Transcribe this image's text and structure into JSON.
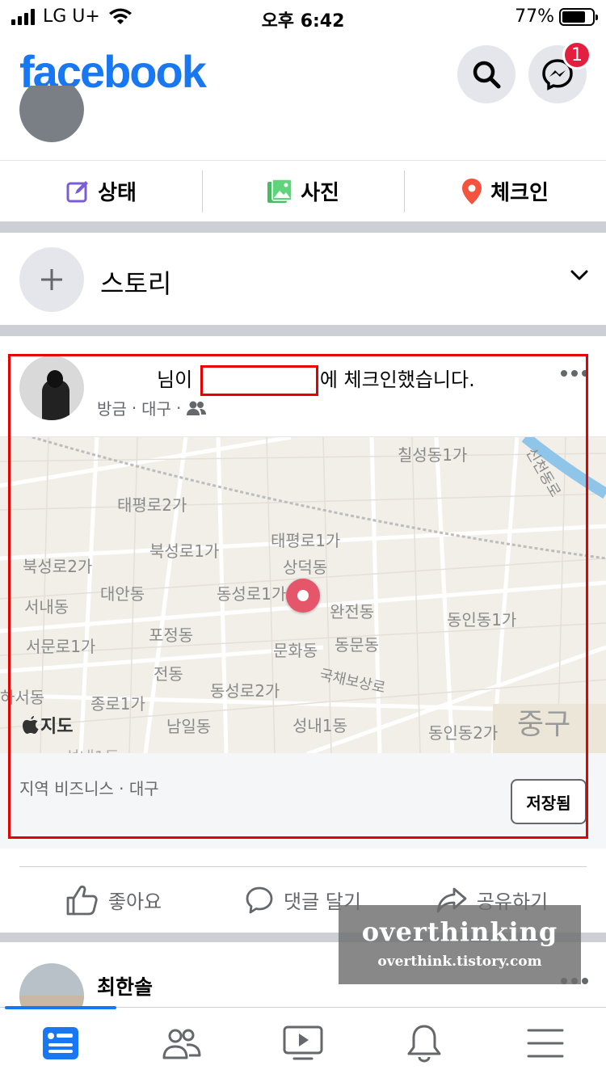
{
  "status_bar": {
    "carrier": "LG U+",
    "time": "오후 6:42",
    "battery": "77%",
    "battery_level": 0.77
  },
  "header": {
    "logo": "facebook",
    "messenger_badge": "1"
  },
  "composer": {
    "actions": [
      {
        "label": "상태",
        "icon": "edit-icon",
        "color": "#7c5cd6"
      },
      {
        "label": "사진",
        "icon": "photo-icon",
        "color": "#45bd62"
      },
      {
        "label": "체크인",
        "icon": "location-pin-icon",
        "color": "#f5533d"
      }
    ]
  },
  "story": {
    "label": "스토리"
  },
  "post": {
    "headline_before": "님이",
    "headline_after": "에 체크인했습니다.",
    "time": "방금",
    "location": "대구",
    "privacy_icon": "friends-icon",
    "map": {
      "labels": [
        "칠성동1가",
        "신천동로",
        "태평로2가",
        "태평로1가",
        "북성로1가",
        "상덕동",
        "북성로2가",
        "대안동",
        "동성로1가",
        "완전동",
        "서내동",
        "동인동1가",
        "포정동",
        "서문로1가",
        "문화동",
        "동문동",
        "전동",
        "하서동",
        "동성로2가",
        "국채보상로",
        "종로1가",
        "남일동",
        "성내1동",
        "동인동2가",
        "성내1동"
      ],
      "district": "중구",
      "brand": "지도"
    },
    "place_subtitle": "지역 비즈니스 · 대구",
    "saved_button": "저장됨",
    "actions": [
      {
        "label": "좋아요",
        "icon": "thumbs-up-icon"
      },
      {
        "label": "댓글 달기",
        "icon": "comment-icon"
      },
      {
        "label": "공유하기",
        "icon": "share-icon"
      }
    ]
  },
  "watermark": {
    "title": "overthinking",
    "url": "overthink.tistory.com"
  },
  "next_post": {
    "author": "최한솔"
  },
  "tabbar": {
    "tabs": [
      {
        "name": "news-feed-icon",
        "active": true
      },
      {
        "name": "friends-icon",
        "active": false
      },
      {
        "name": "watch-icon",
        "active": false
      },
      {
        "name": "bell-icon",
        "active": false
      },
      {
        "name": "menu-icon",
        "active": false
      }
    ],
    "active_color": "#1877f2"
  }
}
